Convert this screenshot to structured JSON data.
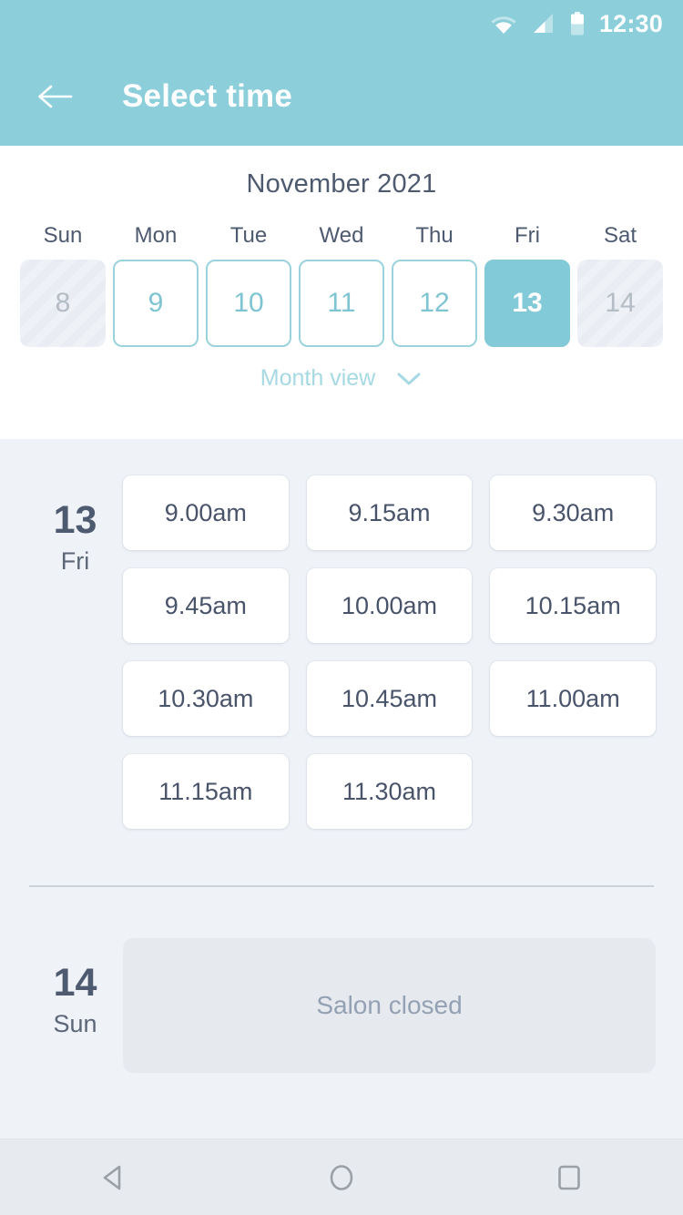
{
  "status_bar": {
    "time": "12:30",
    "icons": [
      "wifi-icon",
      "cellular-signal-icon",
      "battery-icon"
    ]
  },
  "app_bar": {
    "back_icon": "back-arrow-icon",
    "title": "Select time"
  },
  "calendar": {
    "month_label": "November 2021",
    "day_of_week_headers": [
      "Sun",
      "Mon",
      "Tue",
      "Wed",
      "Thu",
      "Fri",
      "Sat"
    ],
    "days": [
      {
        "number": "8",
        "state": "disabled"
      },
      {
        "number": "9",
        "state": "available"
      },
      {
        "number": "10",
        "state": "available"
      },
      {
        "number": "11",
        "state": "available"
      },
      {
        "number": "12",
        "state": "available"
      },
      {
        "number": "13",
        "state": "selected"
      },
      {
        "number": "14",
        "state": "disabled"
      }
    ],
    "view_toggle_label": "Month view",
    "view_toggle_icon": "chevron-down-icon"
  },
  "schedule": {
    "days": [
      {
        "day_number": "13",
        "day_of_week": "Fri",
        "closed": false,
        "slots": [
          "9.00am",
          "9.15am",
          "9.30am",
          "9.45am",
          "10.00am",
          "10.15am",
          "10.30am",
          "10.45am",
          "11.00am",
          "11.15am",
          "11.30am"
        ]
      },
      {
        "day_number": "14",
        "day_of_week": "Sun",
        "closed": true,
        "closed_message": "Salon closed",
        "slots": []
      }
    ]
  },
  "nav_bar": {
    "back_label": "back-triangle-icon",
    "home_label": "home-circle-icon",
    "recents_label": "recents-square-icon"
  },
  "colors": {
    "accent_teal": "#82cad8",
    "header_teal": "#8ccfdb",
    "body_bg": "#eff2f7",
    "text_slate": "#4e5a70",
    "muted": "#94a0b3"
  }
}
